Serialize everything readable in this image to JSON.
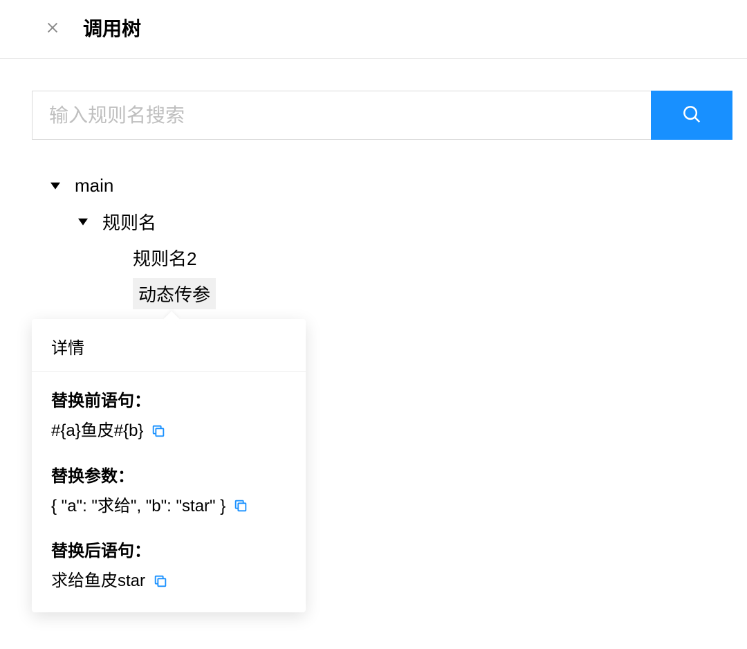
{
  "header": {
    "title": "调用树"
  },
  "search": {
    "placeholder": "输入规则名搜索"
  },
  "tree": {
    "root_label": "main",
    "child_label": "规则名",
    "grandchild1_label": "规则名2",
    "grandchild2_label": "动态传参"
  },
  "popover": {
    "title": "详情",
    "before_label": "替换前语句：",
    "before_value": "#{a}鱼皮#{b}",
    "params_label": "替换参数：",
    "params_value": "{ \"a\": \"求给\", \"b\": \"star\" }",
    "after_label": "替换后语句：",
    "after_value": "求给鱼皮star"
  }
}
